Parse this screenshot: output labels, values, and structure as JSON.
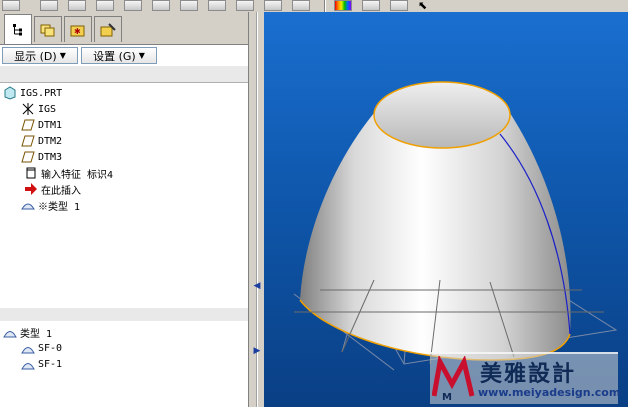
{
  "toolbar": {
    "icons": [
      "view-icon",
      "view-icon",
      "view-icon",
      "view-icon",
      "view-icon",
      "view-icon",
      "view-icon",
      "view-icon",
      "view-icon",
      "view-icon",
      "view-icon",
      "color-icon",
      "view-icon",
      "view-icon",
      "pointer-icon"
    ]
  },
  "tabs": [
    "model-tree-tab",
    "layers-tab",
    "folder-tab",
    "favorites-tab"
  ],
  "menu": {
    "show_label": "显示 (D)",
    "settings_label": "设置 (G)"
  },
  "tree": {
    "root": "IGS.PRT",
    "items": [
      {
        "label": "IGS",
        "icon": "csys-icon"
      },
      {
        "label": "DTM1",
        "icon": "datum-plane-icon"
      },
      {
        "label": "DTM2",
        "icon": "datum-plane-icon"
      },
      {
        "label": "DTM3",
        "icon": "datum-plane-icon"
      },
      {
        "label": "输入特征 标识4",
        "icon": "import-feature-icon"
      },
      {
        "label": "在此插入",
        "icon": "insert-arrow-icon"
      },
      {
        "label": "※类型 1",
        "icon": "quilt-icon"
      }
    ]
  },
  "tree2": {
    "root": "类型 1",
    "items": [
      "SF-0",
      "SF-1"
    ]
  },
  "watermark": {
    "text": "美雅設計",
    "url": "www.meiyadesign.com",
    "logo": "M"
  },
  "colors": {
    "viewport_top": "#1a6fd0",
    "viewport_bottom": "#0a3f84",
    "edge": "#f0a000",
    "curve": "#1a20c8"
  }
}
